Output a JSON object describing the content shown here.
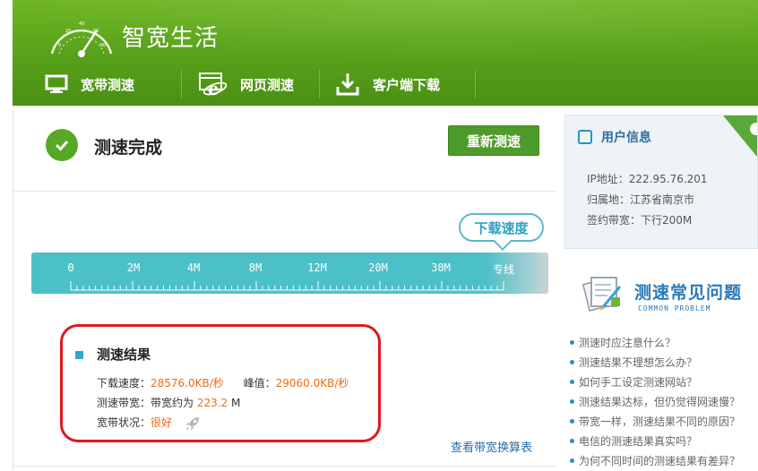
{
  "header": {
    "brand": "智宽生活",
    "nav": [
      {
        "label": "宽带测速",
        "icon": "monitor-icon"
      },
      {
        "label": "网页测速",
        "icon": "ie-browser-icon"
      },
      {
        "label": "客户端下载",
        "icon": "download-icon"
      }
    ]
  },
  "status": {
    "title": "测速完成",
    "retest_label": "重新测速"
  },
  "speed_scale": {
    "bubble": "下载速度",
    "labels": [
      "0",
      "2M",
      "4M",
      "8M",
      "12M",
      "20M",
      "30M",
      "专线"
    ]
  },
  "result": {
    "title": "测速结果",
    "download_label": "下载速度：",
    "download_value": "28576.0KB/秒",
    "peak_label": "峰值：",
    "peak_value": "29060.0KB/秒",
    "bandwidth_label": "测速带宽：带宽约为 ",
    "bandwidth_value": "223.2",
    "bandwidth_unit": " M",
    "condition_label": "宽带状况：",
    "condition_value": "很好"
  },
  "conversion_link": "查看带宽换算表",
  "user_info": {
    "title": "用户信息",
    "ip": "IP地址：222.95.76.201",
    "location": "归属地：江苏省南京市",
    "plan": "签约带宽：下行200M"
  },
  "faq": {
    "title": "测速常见问题",
    "subtitle": "COMMON PROBLEM",
    "items": [
      "测速时应注意什么？",
      "测速结果不理想怎么办？",
      "如何手工设定测速网站？",
      "测速结果达标，但仍觉得网速慢？",
      "带宽一样，测速结果不同的原因？",
      "电信的测速结果真实吗？",
      "为何不同时间的测速结果有差异？"
    ]
  },
  "colors": {
    "header_green": "#57a01a",
    "button_green": "#4e9a2a",
    "scale_teal": "#4cc0c7",
    "highlight_orange": "#f06a10",
    "annotation_red": "#e0181e",
    "link_blue": "#2a6ea8"
  }
}
